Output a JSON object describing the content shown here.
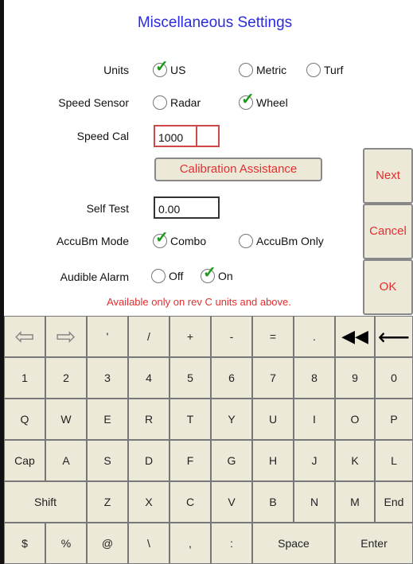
{
  "title": "Miscellaneous Settings",
  "units": {
    "label": "Units",
    "options": [
      "US",
      "Metric",
      "Turf"
    ],
    "selected": "US"
  },
  "speed_sensor": {
    "label": "Speed Sensor",
    "options": [
      "Radar",
      "Wheel"
    ],
    "selected": "Wheel"
  },
  "speed_cal": {
    "label": "Speed Cal",
    "value": "1000"
  },
  "calibration_button": "Calibration Assistance",
  "self_test": {
    "label": "Self Test",
    "value": "0.00"
  },
  "accubm_mode": {
    "label": "AccuBm Mode",
    "options": [
      "Combo",
      "AccuBm Only"
    ],
    "selected": "Combo"
  },
  "audible_alarm": {
    "label": "Audible Alarm",
    "options": [
      "Off",
      "On"
    ],
    "selected": "On"
  },
  "note": "Available only on rev C units and above.",
  "side_buttons": {
    "next": "Next",
    "cancel": "Cancel",
    "ok": "OK"
  },
  "keyboard": {
    "row0": [
      "⇦",
      "⇨",
      "'",
      "/",
      "+",
      "-",
      "=",
      ".",
      "◀◀",
      "⟵"
    ],
    "row1": [
      "1",
      "2",
      "3",
      "4",
      "5",
      "6",
      "7",
      "8",
      "9",
      "0"
    ],
    "row2": [
      "Q",
      "W",
      "E",
      "R",
      "T",
      "Y",
      "U",
      "I",
      "O",
      "P"
    ],
    "row3": [
      "Cap",
      "A",
      "S",
      "D",
      "F",
      "G",
      "H",
      "J",
      "K",
      "L"
    ],
    "row4": [
      "Shift",
      "Z",
      "X",
      "C",
      "V",
      "B",
      "N",
      "M",
      "End"
    ],
    "row5": [
      "$",
      "%",
      "@",
      "\\",
      ",",
      ":",
      "Space",
      "Enter"
    ]
  },
  "colors": {
    "title": "#2a2ae0",
    "accent_red": "#e03030",
    "check": "#1a9a1a",
    "keyboard_bg": "#ece9d8"
  }
}
